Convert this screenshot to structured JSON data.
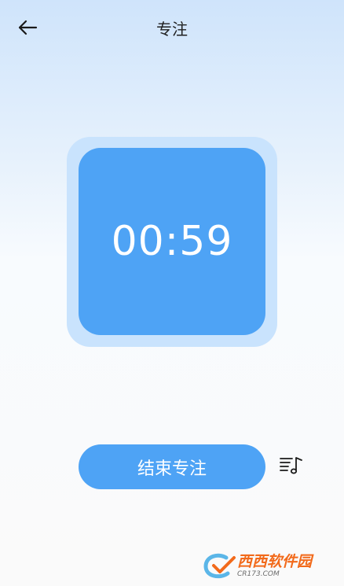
{
  "header": {
    "title": "专注",
    "back_icon": "arrow-left-icon"
  },
  "timer": {
    "time": "00:59"
  },
  "actions": {
    "end_label": "结束专注",
    "music_icon": "music-playlist-icon"
  },
  "watermark": {
    "name": "西西软件园",
    "site": "CR173.COM"
  },
  "colors": {
    "accent": "#4ea3f5",
    "accent_light": "#c9e3fd",
    "background_top": "#cfe4fb",
    "background_bottom": "#fafafa"
  }
}
